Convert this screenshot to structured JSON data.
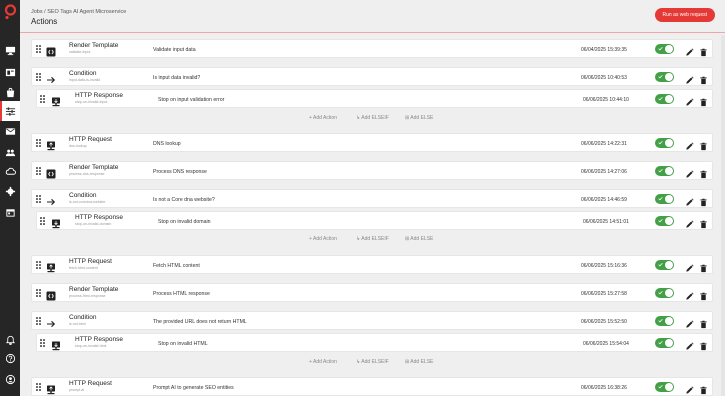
{
  "header": {
    "breadcrumb": "Jobs / SEO Tags AI Agent Microservice",
    "title": "Actions",
    "run_button": "Run as web request"
  },
  "sidebar": {
    "items": [
      {
        "icon": "monitor-icon"
      },
      {
        "icon": "window-icon"
      },
      {
        "icon": "bag-icon"
      },
      {
        "icon": "sliders-icon",
        "active": true
      },
      {
        "icon": "mail-icon"
      },
      {
        "icon": "users-icon"
      },
      {
        "icon": "cloud-sync-icon"
      },
      {
        "icon": "gear-icon"
      },
      {
        "icon": "calendar-icon"
      },
      {
        "icon": "bell-icon"
      },
      {
        "icon": "help-icon"
      },
      {
        "icon": "account-icon"
      }
    ]
  },
  "add_labels": {
    "action": "+ Add Action",
    "elseif": "↳ Add ELSEIF",
    "else": "⊞ Add ELSE"
  },
  "rows": [
    {
      "type": "render",
      "name": "Render Template",
      "slug": "validate-input",
      "desc": "Validate input data",
      "date": "06/04/2025 15:39:35",
      "child": false
    },
    {
      "type": "condition",
      "name": "Condition",
      "slug": "input-data-is-invalid",
      "desc": "Is input data invalid?",
      "date": "06/06/2025 10:40:53",
      "child": false
    },
    {
      "type": "response",
      "name": "HTTP Response",
      "slug": "stop-on-invalid-input",
      "desc": "Stop on input validation error",
      "date": "06/06/2025 10:44:10",
      "child": true
    },
    {
      "type": "request",
      "name": "HTTP Request",
      "slug": "dns-lookup",
      "desc": "DNS lookup",
      "date": "06/06/2025 14:22:31",
      "child": false
    },
    {
      "type": "render",
      "name": "Render Template",
      "slug": "process-dns-response",
      "desc": "Process DNS response",
      "date": "06/06/2025 14:27:06",
      "child": false
    },
    {
      "type": "condition",
      "name": "Condition",
      "slug": "is-not-coredna-website",
      "desc": "Is not a Core dna website?",
      "date": "06/06/2025 14:46:59",
      "child": false
    },
    {
      "type": "response",
      "name": "HTTP Response",
      "slug": "stop-on-invalid-domain",
      "desc": "Stop on invalid domain",
      "date": "06/06/2025 14:51:01",
      "child": true
    },
    {
      "type": "request",
      "name": "HTTP Request",
      "slug": "fetch-html-content",
      "desc": "Fetch HTML content",
      "date": "06/06/2025 15:16:36",
      "child": false
    },
    {
      "type": "render",
      "name": "Render Template",
      "slug": "process-html-response",
      "desc": "Process HTML response",
      "date": "06/06/2025 15:27:58",
      "child": false
    },
    {
      "type": "condition",
      "name": "Condition",
      "slug": "is-not-html",
      "desc": "The provided URL does not return HTML",
      "date": "06/06/2025 15:52:50",
      "child": false
    },
    {
      "type": "response",
      "name": "HTTP Response",
      "slug": "stop-on-invalid-html",
      "desc": "Stop on invalid HTML",
      "date": "06/06/2025 15:54:04",
      "child": true
    },
    {
      "type": "request",
      "name": "HTTP Request",
      "slug": "prompt-ai",
      "desc": "Prompt AI to generate SEO entities",
      "date": "06/06/2025 16:38:26",
      "child": false
    }
  ]
}
